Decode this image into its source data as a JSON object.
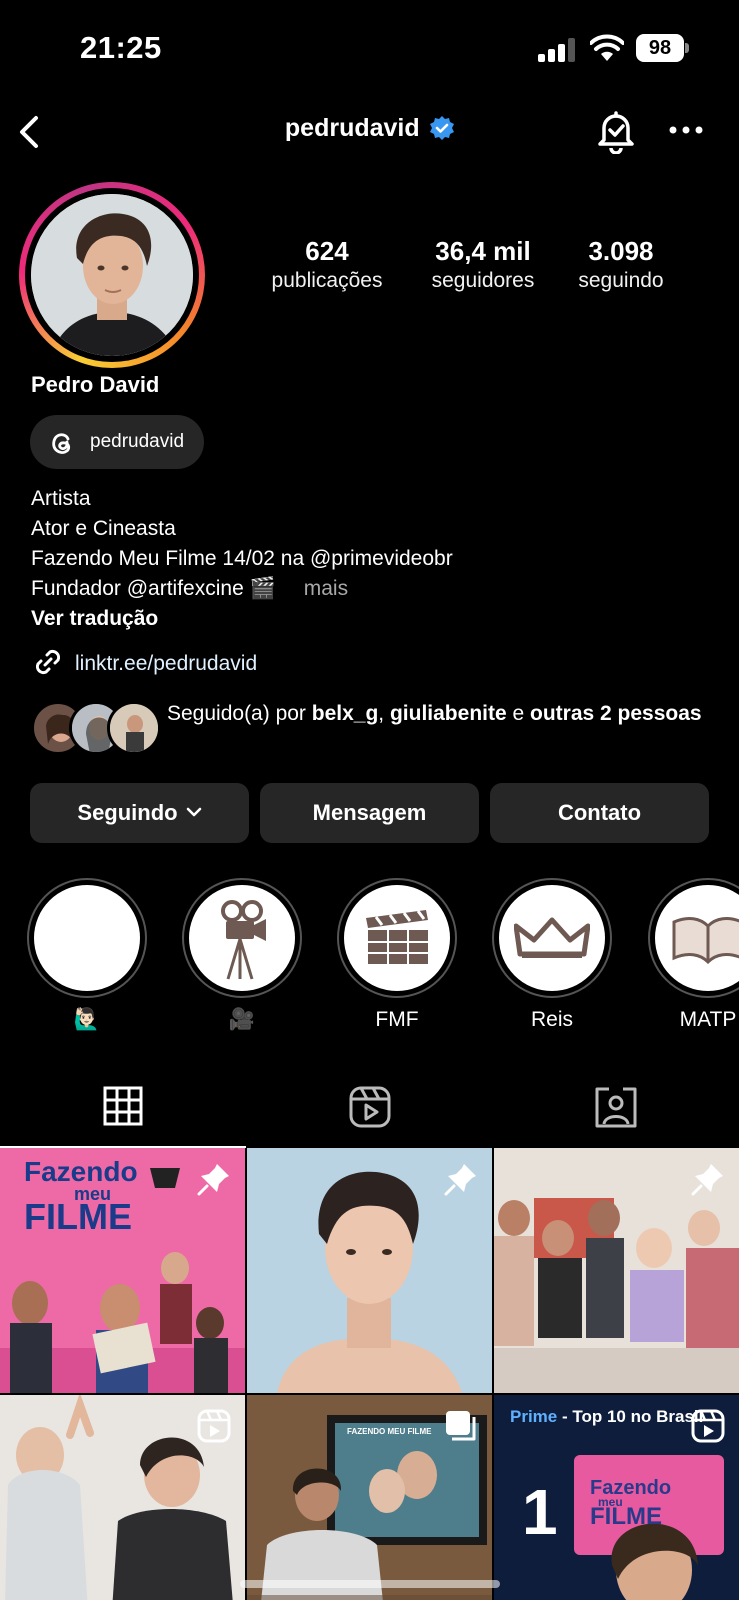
{
  "status_bar": {
    "time": "21:25",
    "battery": "98"
  },
  "header": {
    "username": "pedrudavid"
  },
  "profile": {
    "stats": [
      {
        "value": "624",
        "label": "publicações"
      },
      {
        "value": "36,4 mil",
        "label": "seguidores"
      },
      {
        "value": "3.098",
        "label": "seguindo"
      }
    ],
    "name": "Pedro David",
    "threads_handle": "pedrudavid",
    "bio": {
      "line1": "Artista",
      "line2": "Ator e Cineasta",
      "line3": "Fazendo Meu Filme 14/02 na @primevideobr",
      "line4": "Fundador @artifexcine 🎬",
      "more": "mais",
      "translate": "Ver tradução"
    },
    "link": "linktr.ee/pedrudavid",
    "followed_by": {
      "prefix": "Seguido(a) por ",
      "user1": "belx_g",
      "sep": ", ",
      "user2": "giuliabenite",
      "mid": " e ",
      "others": "outras 2 pessoas"
    }
  },
  "actions": {
    "following": "Seguindo",
    "message": "Mensagem",
    "contact": "Contato"
  },
  "highlights": [
    {
      "label": "🙋🏻‍♂️"
    },
    {
      "label": "🎥"
    },
    {
      "label": "FMF"
    },
    {
      "label": "Reis"
    },
    {
      "label": "MATP"
    }
  ],
  "grid": {
    "post1_title_a": "Fazendo",
    "post1_title_b": "meu",
    "post1_title_c": "FILME",
    "post6_banner_a": "Prime",
    "post6_banner_b": " - Top 10 no Brasil",
    "post6_number": "1",
    "post6_logo_a": "Fazendo",
    "post6_logo_b": "meu",
    "post6_logo_c": "FILME",
    "post5_caption": "FAZENDO MEU FILME"
  },
  "colors": {
    "background": "#000000",
    "button": "#262626",
    "verified": "#3897f0",
    "link": "#e0f1ff",
    "muted": "#a8a8a8"
  }
}
